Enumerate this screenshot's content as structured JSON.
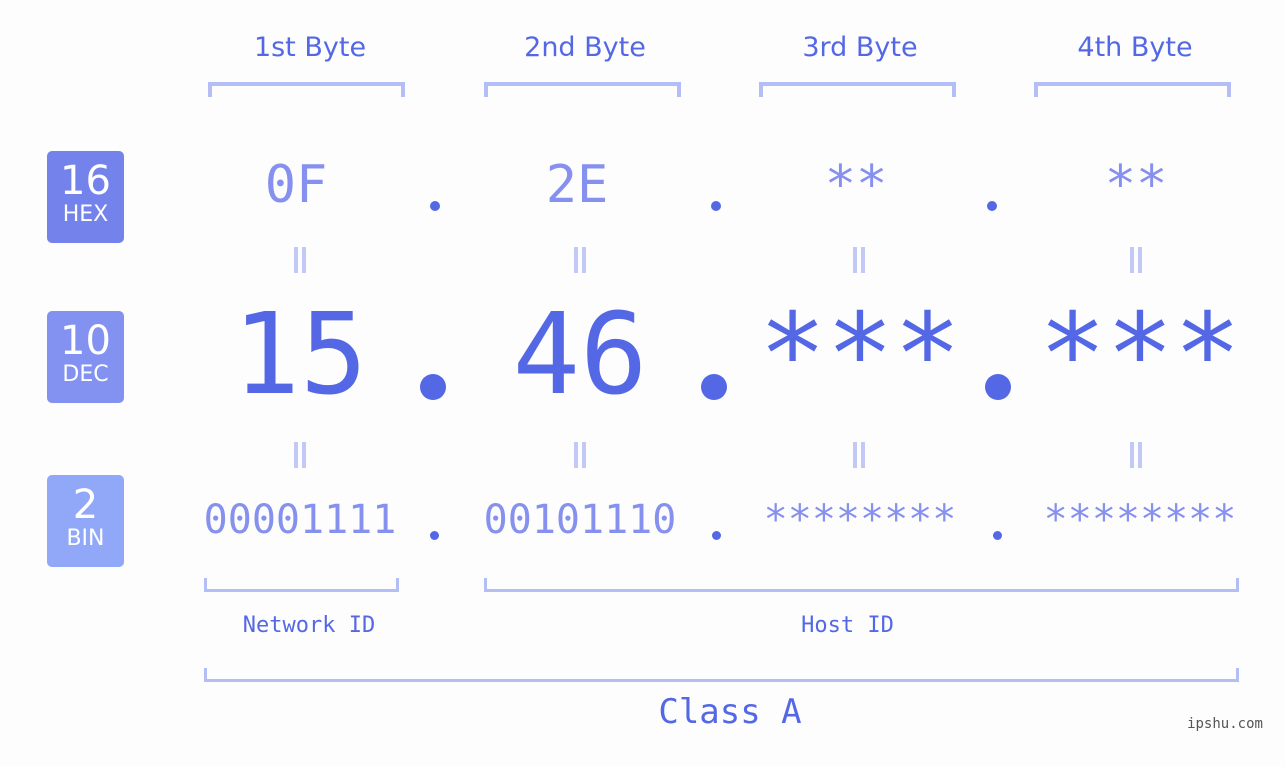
{
  "bytes": {
    "headers": [
      "1st Byte",
      "2nd Byte",
      "3rd Byte",
      "4th Byte"
    ]
  },
  "bases": {
    "hex": {
      "number": "16",
      "label": "HEX",
      "color": "#7383eb"
    },
    "dec": {
      "number": "10",
      "label": "DEC",
      "color": "#8391f0"
    },
    "bin": {
      "number": "2",
      "label": "BIN",
      "color": "#91a8f8"
    }
  },
  "values": {
    "hex": [
      "0F",
      "2E",
      "**",
      "**"
    ],
    "dec": [
      "15",
      "46",
      "***",
      "***"
    ],
    "bin": [
      "00001111",
      "00101110",
      "********",
      "********"
    ]
  },
  "segments": {
    "network": "Network ID",
    "host": "Host ID",
    "class": "Class A"
  },
  "watermark": "ipshu.com",
  "colors": {
    "accent": "#5468e6",
    "light": "#8690ee",
    "bracket": "#b3bdf6"
  }
}
